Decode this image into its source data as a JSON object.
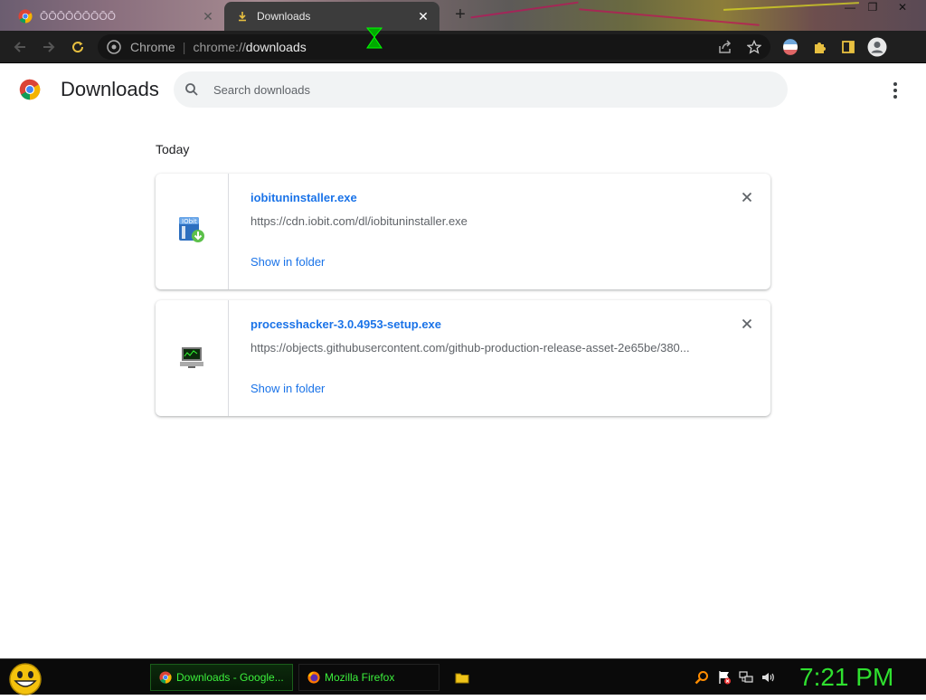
{
  "browser": {
    "tabs": [
      {
        "label": "ŌŌŌŌŌŌŌŌŌ",
        "active": false
      },
      {
        "label": "Downloads",
        "active": true
      }
    ],
    "omnibox": {
      "origin": "Chrome",
      "scheme": "chrome://",
      "host": "downloads"
    }
  },
  "page": {
    "title": "Downloads",
    "search_placeholder": "Search downloads",
    "section": "Today",
    "items": [
      {
        "filename": "iobituninstaller.exe",
        "url": "https://cdn.iobit.com/dl/iobituninstaller.exe",
        "action": "Show in folder",
        "icon": "iobit-installer-icon"
      },
      {
        "filename": "processhacker-3.0.4953-setup.exe",
        "url": "https://objects.githubusercontent.com/github-production-release-asset-2e65be/380...",
        "action": "Show in folder",
        "icon": "monitor-setup-icon"
      }
    ]
  },
  "taskbar": {
    "tasks": [
      {
        "label": "Downloads - Google...",
        "active": true,
        "icon": "chrome-icon"
      },
      {
        "label": "Mozilla Firefox",
        "active": false,
        "icon": "firefox-icon"
      }
    ],
    "clock": "7:21 PM"
  },
  "colors": {
    "accent": "#1a73e8",
    "taskbar_text": "#3cf03c",
    "clock": "#2fe02f"
  }
}
